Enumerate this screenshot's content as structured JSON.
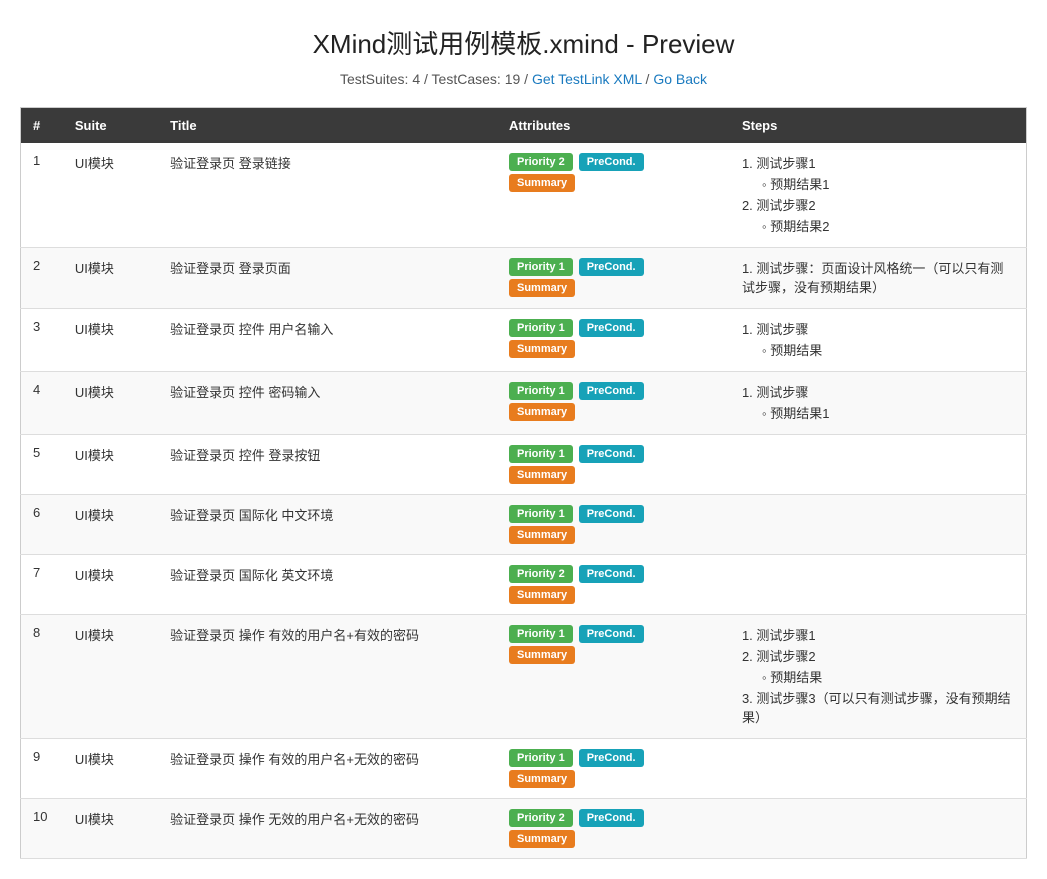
{
  "header": {
    "title": "XMind测试用例模板.xmind - Preview",
    "meta": {
      "text": "TestSuites: 4 / TestCases: 19 /",
      "link1": "Get TestLink XML",
      "separator": "/",
      "link2": "Go Back",
      "suites_count": "4",
      "cases_count": "19"
    }
  },
  "table": {
    "columns": [
      {
        "id": "num",
        "label": "#"
      },
      {
        "id": "suite",
        "label": "Suite"
      },
      {
        "id": "title",
        "label": "Title"
      },
      {
        "id": "attributes",
        "label": "Attributes"
      },
      {
        "id": "steps",
        "label": "Steps"
      }
    ],
    "rows": [
      {
        "num": "1",
        "suite": "UI模块",
        "title": "验证登录页 登录链接",
        "priority": "Priority 2",
        "priority_class": "badge-priority2",
        "precond": "PreCond.",
        "summary": "Summary",
        "steps": [
          {
            "type": "step",
            "num": "1",
            "text": "测试步骤1"
          },
          {
            "type": "sub",
            "text": "预期结果1"
          },
          {
            "type": "step",
            "num": "2",
            "text": "测试步骤2"
          },
          {
            "type": "sub",
            "text": "预期结果2"
          }
        ]
      },
      {
        "num": "2",
        "suite": "UI模块",
        "title": "验证登录页 登录页面",
        "priority": "Priority 1",
        "priority_class": "badge-priority1",
        "precond": "PreCond.",
        "summary": "Summary",
        "steps": [
          {
            "type": "step",
            "num": "1",
            "text": "测试步骤：页面设计风格统一（可以只有测试步骤，没有预期结果）"
          }
        ]
      },
      {
        "num": "3",
        "suite": "UI模块",
        "title": "验证登录页 控件 用户名输入",
        "priority": "Priority 1",
        "priority_class": "badge-priority1",
        "precond": "PreCond.",
        "summary": "Summary",
        "steps": [
          {
            "type": "step",
            "num": "1",
            "text": "测试步骤"
          },
          {
            "type": "sub",
            "text": "预期结果"
          }
        ]
      },
      {
        "num": "4",
        "suite": "UI模块",
        "title": "验证登录页 控件 密码输入",
        "priority": "Priority 1",
        "priority_class": "badge-priority1",
        "precond": "PreCond.",
        "summary": "Summary",
        "steps": [
          {
            "type": "step",
            "num": "1",
            "text": "测试步骤"
          },
          {
            "type": "sub",
            "text": "预期结果1"
          }
        ]
      },
      {
        "num": "5",
        "suite": "UI模块",
        "title": "验证登录页 控件 登录按钮",
        "priority": "Priority 1",
        "priority_class": "badge-priority1",
        "precond": "PreCond.",
        "summary": "Summary",
        "steps": []
      },
      {
        "num": "6",
        "suite": "UI模块",
        "title": "验证登录页 国际化 中文环境",
        "priority": "Priority 1",
        "priority_class": "badge-priority1",
        "precond": "PreCond.",
        "summary": "Summary",
        "steps": []
      },
      {
        "num": "7",
        "suite": "UI模块",
        "title": "验证登录页 国际化 英文环境",
        "priority": "Priority 2",
        "priority_class": "badge-priority2",
        "precond": "PreCond.",
        "summary": "Summary",
        "steps": []
      },
      {
        "num": "8",
        "suite": "UI模块",
        "title": "验证登录页 操作 有效的用户名+有效的密码",
        "priority": "Priority 1",
        "priority_class": "badge-priority1",
        "precond": "PreCond.",
        "summary": "Summary",
        "steps": [
          {
            "type": "step",
            "num": "1",
            "text": "测试步骤1"
          },
          {
            "type": "step",
            "num": "2",
            "text": "测试步骤2"
          },
          {
            "type": "sub",
            "text": "预期结果"
          },
          {
            "type": "step",
            "num": "3",
            "text": "测试步骤3（可以只有测试步骤，没有预期结果）"
          }
        ]
      },
      {
        "num": "9",
        "suite": "UI模块",
        "title": "验证登录页 操作 有效的用户名+无效的密码",
        "priority": "Priority 1",
        "priority_class": "badge-priority1",
        "precond": "PreCond.",
        "summary": "Summary",
        "steps": []
      },
      {
        "num": "10",
        "suite": "UI模块",
        "title": "验证登录页 操作 无效的用户名+无效的密码",
        "priority": "Priority 2",
        "priority_class": "badge-priority2",
        "precond": "PreCond.",
        "summary": "Summary",
        "steps": []
      }
    ]
  }
}
